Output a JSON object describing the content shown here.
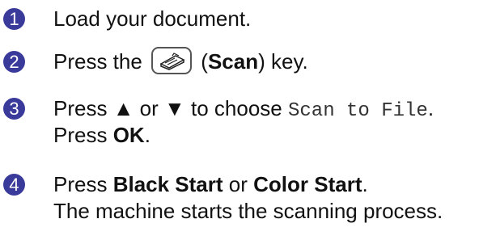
{
  "accent_color": "#3a3a9b",
  "steps": [
    {
      "num": "1",
      "line1": "Load your document."
    },
    {
      "num": "2",
      "pre": "Press the",
      "key_icon": "scanner-icon",
      "bold": "Scan",
      "post": "key."
    },
    {
      "num": "3",
      "pre": "Press",
      "up": "▲",
      "or": "or",
      "down": "▼",
      "mid": "to choose",
      "code": "Scan to File",
      "end": ".",
      "line2_pre": "Press",
      "line2_bold": "OK",
      "line2_end": "."
    },
    {
      "num": "4",
      "pre": "Press",
      "bold1": "Black Start",
      "or": "or",
      "bold2": "Color Start",
      "end": ".",
      "line2": "The machine starts the scanning process."
    }
  ]
}
